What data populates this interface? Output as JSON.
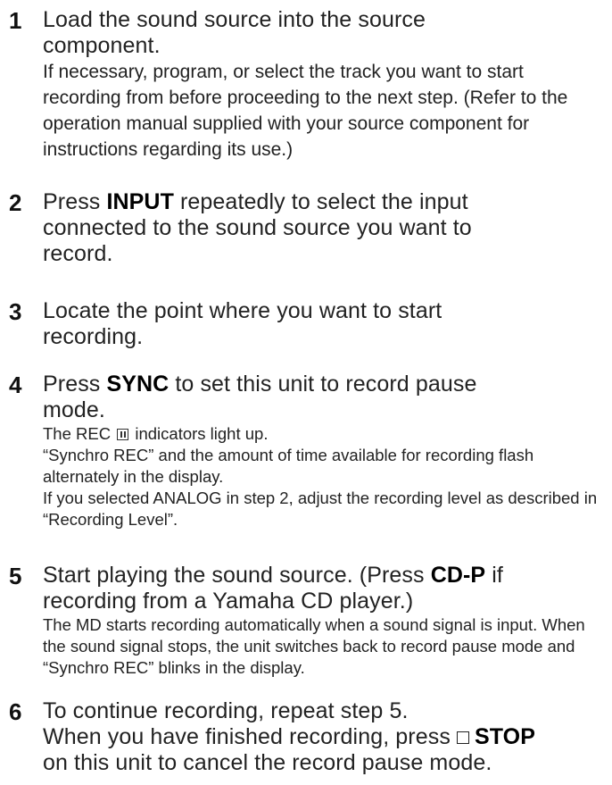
{
  "steps": [
    {
      "number": "1",
      "heading": "Load the sound source into the source component.",
      "detail": "If necessary, program, or select the track you want to start recording from before proceeding to the next step. (Refer to the operation manual supplied with your source component for instructions regarding its use.)"
    },
    {
      "number": "2",
      "heading_pre": "Press ",
      "heading_bold": "INPUT",
      "heading_post": " repeatedly to select the input connected to the sound source you want to record."
    },
    {
      "number": "3",
      "heading": "Locate the point where you want to start recording."
    },
    {
      "number": "4",
      "heading_pre": "Press ",
      "heading_bold": "SYNC",
      "heading_post": " to set this unit to record pause mode.",
      "note1_pre": "The REC ",
      "note1_post": " indicators light up.",
      "note2": "“Synchro REC” and the amount of time available for recording flash alternately in the display.",
      "note3": "If you selected ANALOG in step 2, adjust the recording level as described in “Recording Level”."
    },
    {
      "number": "5",
      "heading_pre": "Start playing the sound source. (Press ",
      "heading_bold": "CD-P",
      "heading_post": " if recording from a Yamaha CD player.)",
      "note1": "The MD starts recording automatically when a sound signal is input. When the sound signal stops, the unit switches back to record pause mode and “Synchro REC” blinks in the display."
    },
    {
      "number": "6",
      "heading": "To continue recording, repeat step 5.",
      "line2": "When you have finished recording, press ",
      "line2_bold": "STOP",
      "line3": "on this unit to cancel the record pause mode."
    }
  ]
}
